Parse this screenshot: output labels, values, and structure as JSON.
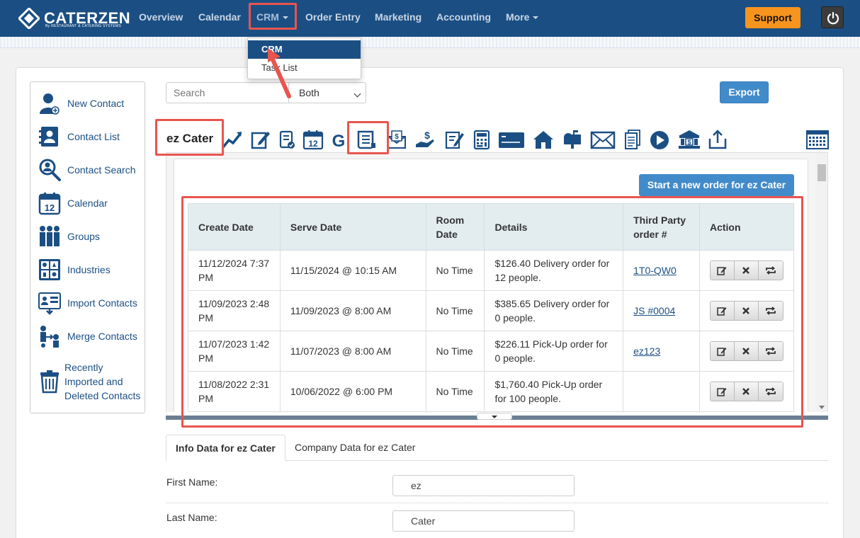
{
  "app": {
    "logo_text": "CATERZEN",
    "logo_sub": "By RESTAURANT & CATERING SYSTEMS"
  },
  "nav": {
    "items": [
      "Overview",
      "Calendar",
      "CRM",
      "Order Entry",
      "Marketing",
      "Accounting",
      "More"
    ],
    "support_label": "Support"
  },
  "crm_menu": {
    "items": [
      "CRM",
      "Task List"
    ]
  },
  "sidebar": {
    "items": [
      "New Contact",
      "Contact List",
      "Contact Search",
      "Calendar",
      "Groups",
      "Industries",
      "Import Contacts",
      "Merge Contacts",
      "Recently Imported and Deleted Contacts"
    ]
  },
  "search": {
    "placeholder": "Search",
    "scope_value": "Both",
    "export_label": "Export"
  },
  "contact": {
    "name": "ez Cater",
    "new_order_label": "Start a new order for ez Cater"
  },
  "orders": {
    "columns": [
      "Create Date",
      "Serve Date",
      "Room Date",
      "Details",
      "Third Party order #",
      "Action"
    ],
    "rows": [
      {
        "create": "11/12/2024 7:37 PM",
        "serve": "11/15/2024 @ 10:15 AM",
        "room": "No Time",
        "details": "$126.40 Delivery order for 12 people.",
        "third_party": "1T0-QW0"
      },
      {
        "create": "11/09/2023 2:48 PM",
        "serve": "11/09/2023 @ 8:00 AM",
        "room": "No Time",
        "details": "$385.65 Delivery order for 0 people.",
        "third_party": "JS #0004"
      },
      {
        "create": "11/07/2023 1:42 PM",
        "serve": "11/07/2023 @ 8:00 AM",
        "room": "No Time",
        "details": "$226.11 Pick-Up order for 0 people.",
        "third_party": "ez123"
      },
      {
        "create": "11/08/2022 2:31 PM",
        "serve": "10/06/2022 @ 6:00 PM",
        "room": "No Time",
        "details": "$1,760.40 Pick-Up order for 100 people.",
        "third_party": ""
      }
    ]
  },
  "tabs": {
    "info": "Info Data for ez Cater",
    "company": "Company Data for ez Cater"
  },
  "form": {
    "first_name_label": "First Name:",
    "first_name_value": "ez",
    "last_name_label": "Last Name:",
    "last_name_value": "Cater"
  },
  "colors": {
    "nav_bg": "#1b4f84",
    "support": "#f7941d",
    "primary_button": "#428bca",
    "highlight": "#e8554e"
  }
}
